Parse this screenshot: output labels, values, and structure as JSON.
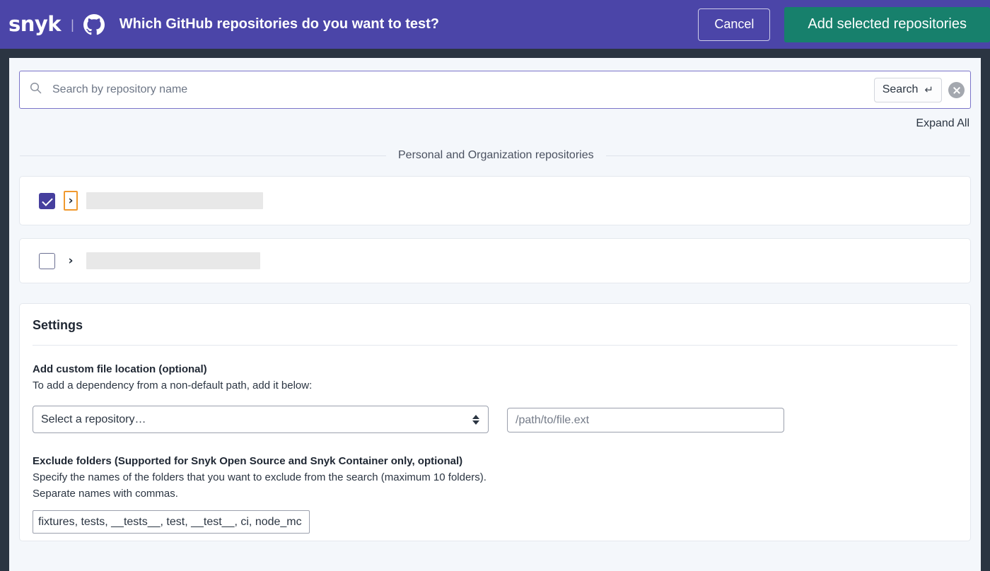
{
  "header": {
    "logo_text": "snyk",
    "github_icon": "github-icon",
    "title": "Which GitHub repositories do you want to test?",
    "cancel_label": "Cancel",
    "add_label": "Add selected repositories",
    "purple": "#4b45a8",
    "teal": "#17806c"
  },
  "search": {
    "placeholder": "Search by repository name",
    "value": "",
    "search_button_label": "Search",
    "enter_glyph": "↵",
    "clear_icon": "close-circle-icon",
    "search_icon": "search-icon"
  },
  "toolbar": {
    "expand_all_label": "Expand All"
  },
  "section": {
    "divider_label": "Personal and Organization repositories"
  },
  "repositories": [
    {
      "checked": true,
      "chevron": "›",
      "chevron_focused": true,
      "name": ""
    },
    {
      "checked": false,
      "chevron": "›",
      "chevron_focused": false,
      "name": ""
    }
  ],
  "settings": {
    "title": "Settings",
    "custom_file": {
      "label": "Add custom file location (optional)",
      "description": "To add a dependency from a non-default path, add it below:",
      "select_value": "Select a repository…",
      "select_options": [
        "Select a repository…"
      ],
      "path_placeholder": "/path/to/file.ext",
      "path_value": ""
    },
    "exclude": {
      "label": "Exclude folders (Supported for Snyk Open Source and Snyk Container only, optional)",
      "description_line1": "Specify the names of the folders that you want to exclude from the search (maximum 10 folders).",
      "description_line2": "Separate names with commas.",
      "value": "fixtures, tests, __tests__, test, __test__, ci, node_mc"
    }
  }
}
